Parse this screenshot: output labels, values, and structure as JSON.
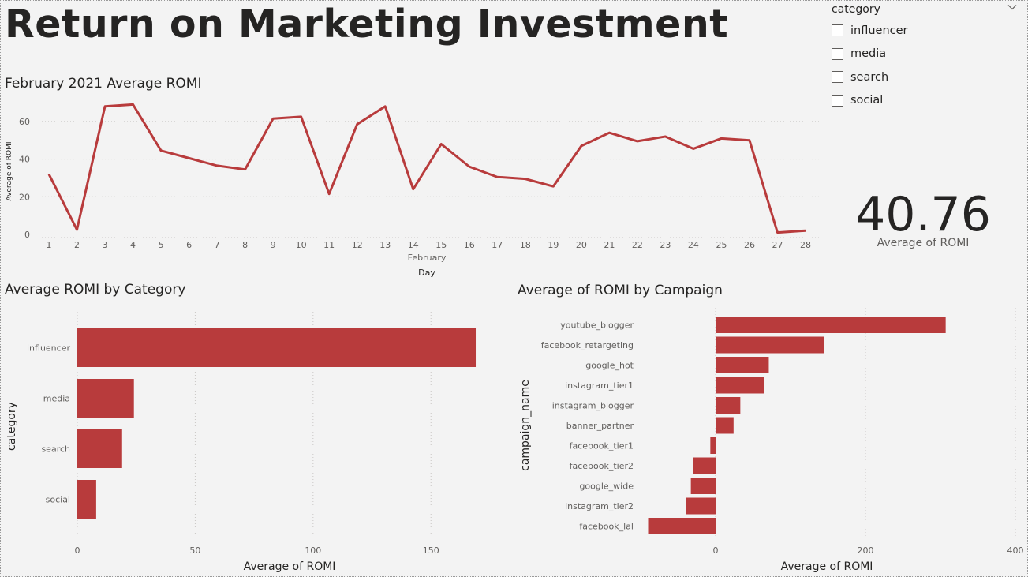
{
  "page": {
    "title": "Return on Marketing Investment"
  },
  "slicer": {
    "title": "category",
    "items": [
      {
        "label": "influencer",
        "checked": false
      },
      {
        "label": "media",
        "checked": false
      },
      {
        "label": "search",
        "checked": false
      },
      {
        "label": "social",
        "checked": false
      }
    ]
  },
  "card": {
    "value": "40.76",
    "label": "Average of ROMI"
  },
  "colors": {
    "accent": "#b83b3c",
    "background": "#f3f3f3",
    "text": "#252423"
  },
  "chart_data": [
    {
      "type": "line",
      "title": "February 2021 Average ROMI",
      "xlabel": "Day",
      "xsublabel": "February",
      "ylabel": "Average of ROMI",
      "ylim": [
        0,
        70
      ],
      "yticks": [
        0,
        20,
        40,
        60
      ],
      "grid": true,
      "x": [
        "1",
        "2",
        "3",
        "4",
        "5",
        "6",
        "7",
        "8",
        "9",
        "10",
        "11",
        "12",
        "13",
        "14",
        "15",
        "16",
        "17",
        "18",
        "19",
        "20",
        "21",
        "22",
        "23",
        "24",
        "25",
        "26",
        "27",
        "28"
      ],
      "series": [
        {
          "values": [
            32,
            2.5,
            68,
            69,
            44.5,
            40.5,
            36.5,
            34.5,
            61.5,
            62.5,
            21.5,
            58.5,
            68,
            24,
            48,
            36,
            30.5,
            29.5,
            25.5,
            47,
            54,
            49.5,
            52,
            45.5,
            51,
            50,
            1,
            2
          ]
        }
      ]
    },
    {
      "type": "bar",
      "orientation": "horizontal",
      "title": "Average ROMI by Category",
      "xlabel": "Average of ROMI",
      "ylabel": "category",
      "xlim": [
        0,
        170
      ],
      "xticks": [
        0,
        50,
        100,
        150
      ],
      "categories": [
        "influencer",
        "media",
        "search",
        "social"
      ],
      "values": [
        169,
        24,
        19,
        8
      ]
    },
    {
      "type": "bar",
      "orientation": "horizontal",
      "title": "Average of ROMI by Campaign",
      "xlabel": "Average of ROMI",
      "ylabel": "campaign_name",
      "xlim": [
        -95,
        400
      ],
      "xticks": [
        0,
        200,
        400
      ],
      "categories": [
        "youtube_blogger",
        "facebook_retargeting",
        "google_hot",
        "instagram_tier1",
        "instagram_blogger",
        "banner_partner",
        "facebook_tier1",
        "facebook_tier2",
        "google_wide",
        "instagram_tier2",
        "facebook_lal"
      ],
      "values": [
        307,
        145,
        71,
        65,
        33,
        24,
        -7,
        -30,
        -33,
        -40,
        -90
      ]
    }
  ]
}
